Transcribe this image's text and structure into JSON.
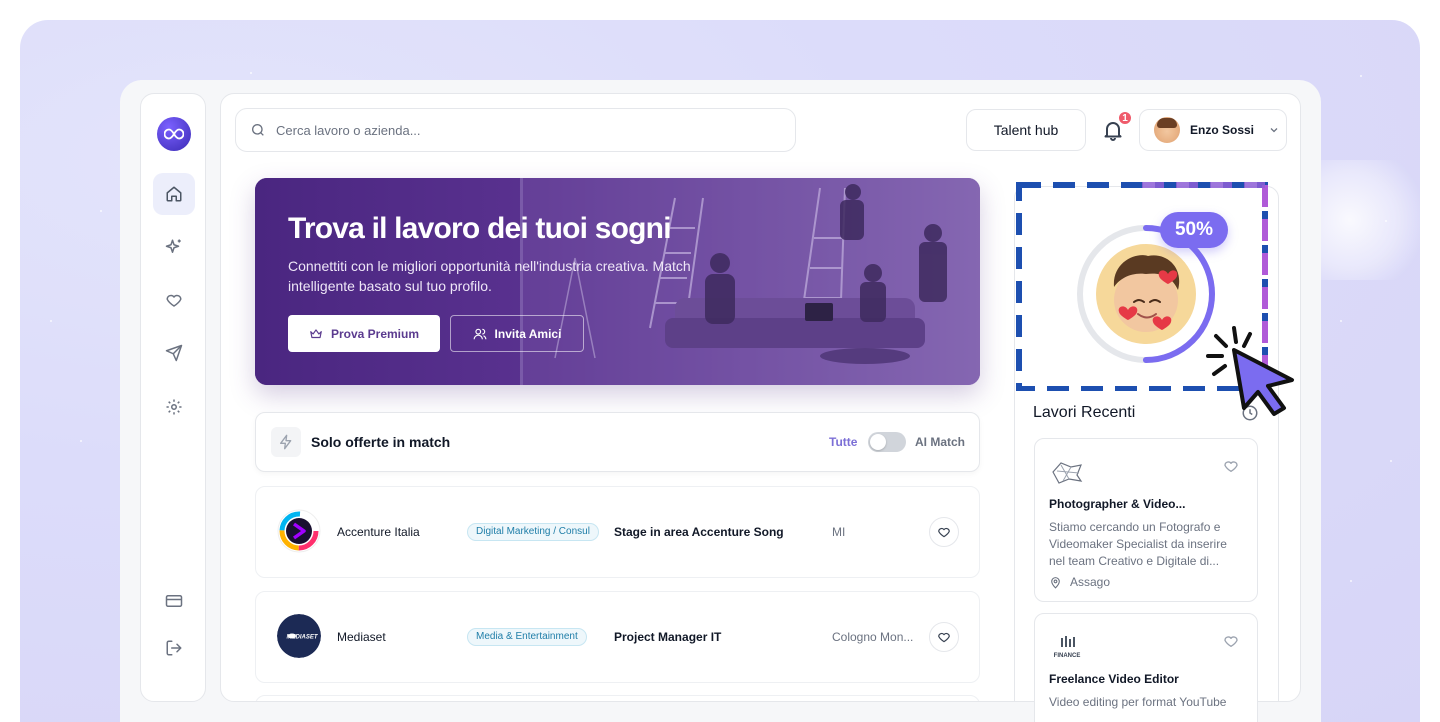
{
  "search": {
    "placeholder": "Cerca lavoro o azienda..."
  },
  "header": {
    "talent_hub_label": "Talent hub",
    "notifications_count": "1",
    "user_name": "Enzo Sossi"
  },
  "sidebar": {
    "items": [
      {
        "icon": "home-icon",
        "active": true
      },
      {
        "icon": "sparkles-icon",
        "active": false
      },
      {
        "icon": "heart-icon",
        "active": false
      },
      {
        "icon": "send-icon",
        "active": false
      },
      {
        "icon": "settings-icon",
        "active": false
      },
      {
        "icon": "credit-card-icon",
        "active": false
      },
      {
        "icon": "logout-icon",
        "active": false
      }
    ]
  },
  "hero": {
    "title": "Trova il lavoro dei tuoi sogni",
    "subtitle": "Connettiti con le migliori opportunità nell'industria creativa. Match intelligente basato sul tuo profilo.",
    "premium_label": "Prova Premium",
    "invite_label": "Invita Amici"
  },
  "filter": {
    "title": "Solo offerte in match",
    "all_label": "Tutte",
    "ai_label": "AI Match",
    "ai_match_enabled": false
  },
  "jobs": [
    {
      "company": "Accenture Italia",
      "tag": "Digital Marketing / Consul",
      "role": "Stage in area Accenture Song",
      "location": "MI"
    },
    {
      "company": "Mediaset",
      "tag": "Media & Entertainment",
      "role": "Project Manager IT",
      "location": "Cologno Mon..."
    }
  ],
  "profile": {
    "completion_label": "50%",
    "completion": 0.5
  },
  "recent": {
    "title": "Lavori Recenti",
    "items": [
      {
        "title": "Photographer & Video...",
        "description": "Stiamo cercando un Fotografo e Videomaker Specialist da inserire nel team Creativo e Digitale di...",
        "location": "Assago",
        "logo_text": ""
      },
      {
        "title": "Freelance Video Editor",
        "description": "Video editing per format YouTube",
        "location": "",
        "logo_text": "FINANCE"
      }
    ]
  },
  "colors": {
    "accent": "#7b6cf0",
    "brand_purple": "#5b3b8f",
    "badge_red": "#ef5b6b",
    "dash_blue": "#1d4fb0",
    "dash_purple": "#b05ad8"
  }
}
